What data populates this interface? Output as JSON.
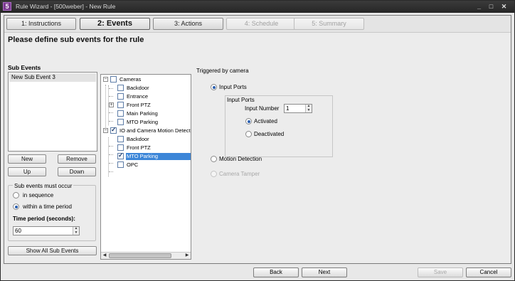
{
  "window": {
    "app_icon": "5",
    "title": "Rule Wizard - [500weber] - New Rule",
    "controls": {
      "minimize": "_",
      "maximize": "□",
      "close": "✕"
    }
  },
  "steps": [
    {
      "label": "1: Instructions",
      "state": "normal"
    },
    {
      "label": "2: Events",
      "state": "active"
    },
    {
      "label": "3: Actions",
      "state": "normal"
    },
    {
      "label": "4: Schedule",
      "state": "disabled"
    },
    {
      "label": "5: Summary",
      "state": "disabled"
    }
  ],
  "page_heading": "Please define sub events for the rule",
  "sub_events": {
    "label": "Sub Events",
    "items": [
      "New Sub Event 3"
    ],
    "buttons": {
      "new": "New",
      "remove": "Remove",
      "up": "Up",
      "down": "Down"
    },
    "occur_group": {
      "title": "Sub events must occur",
      "options": [
        {
          "label": "in sequence",
          "selected": false
        },
        {
          "label": "within a time period",
          "selected": true
        }
      ],
      "time_period_label": "Time period (seconds):",
      "time_period_value": "60"
    },
    "show_all_label": "Show All Sub Events"
  },
  "tree": {
    "nodes": [
      {
        "label": "Cameras",
        "level": 0,
        "checked": false,
        "expander": "−"
      },
      {
        "label": "Backdoor",
        "level": 1,
        "checked": false
      },
      {
        "label": "Entrance",
        "level": 1,
        "checked": false
      },
      {
        "label": "Front PTZ",
        "level": 1,
        "checked": false,
        "expander": "+"
      },
      {
        "label": "Main Parking",
        "level": 1,
        "checked": false
      },
      {
        "label": "MTO Parking",
        "level": 1,
        "checked": false
      },
      {
        "label": "IO and Camera Motion Detection",
        "level": 0,
        "checked": true,
        "expander": "−"
      },
      {
        "label": "Backdoor",
        "level": 1,
        "checked": false
      },
      {
        "label": "Front PTZ",
        "level": 1,
        "checked": false
      },
      {
        "label": "MTO Parking",
        "level": 1,
        "checked": true,
        "selected": true
      },
      {
        "label": "OPC",
        "level": 1,
        "checked": false
      }
    ]
  },
  "trigger": {
    "label": "Triggered by camera",
    "options": {
      "input_ports": {
        "label": "Input Ports",
        "selected": true
      },
      "motion_detection": {
        "label": "Motion Detection",
        "selected": false
      },
      "camera_tamper": {
        "label": "Camera Tamper",
        "selected": false,
        "disabled": true
      }
    },
    "ports_group": {
      "title": "Input Ports",
      "input_number_label": "Input Number",
      "input_number_value": "1",
      "activated": {
        "label": "Activated",
        "selected": true
      },
      "deactivated": {
        "label": "Deactivated",
        "selected": false
      }
    }
  },
  "footer": {
    "back": "Back",
    "next": "Next",
    "save": "Save",
    "cancel": "Cancel"
  }
}
